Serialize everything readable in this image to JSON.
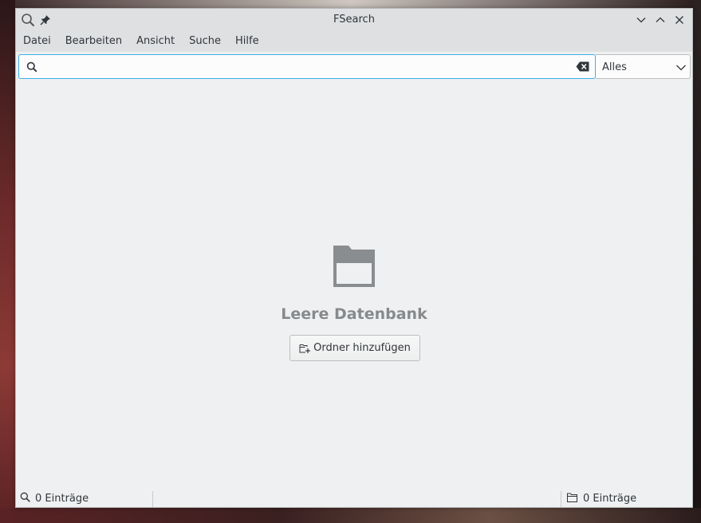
{
  "window": {
    "title": "FSearch"
  },
  "menubar": {
    "items": [
      {
        "label": "Datei"
      },
      {
        "label": "Bearbeiten"
      },
      {
        "label": "Ansicht"
      },
      {
        "label": "Suche"
      },
      {
        "label": "Hilfe"
      }
    ]
  },
  "search": {
    "value": "",
    "placeholder": "",
    "filter_selected": "Alles"
  },
  "empty_state": {
    "title": "Leere Datenbank",
    "add_button_label": "Ordner hinzufügen"
  },
  "statusbar": {
    "search_count": "0 Einträge",
    "db_count": "0 Einträge"
  },
  "icons": {
    "titlebar": [
      "search-icon",
      "pin-icon",
      "minimize-icon",
      "maximize-icon",
      "close-icon"
    ],
    "search": [
      "search-icon",
      "clear-icon",
      "chevron-down-icon"
    ],
    "empty": [
      "folder-icon",
      "folder-add-icon"
    ],
    "status": [
      "search-icon",
      "folder-icon"
    ]
  },
  "colors": {
    "accent": "#3daee9",
    "window_bg": "#eff0f1",
    "titlebar_bg": "#dee0e2",
    "empty_icon": "#8a8d90",
    "text": "#31363b"
  }
}
